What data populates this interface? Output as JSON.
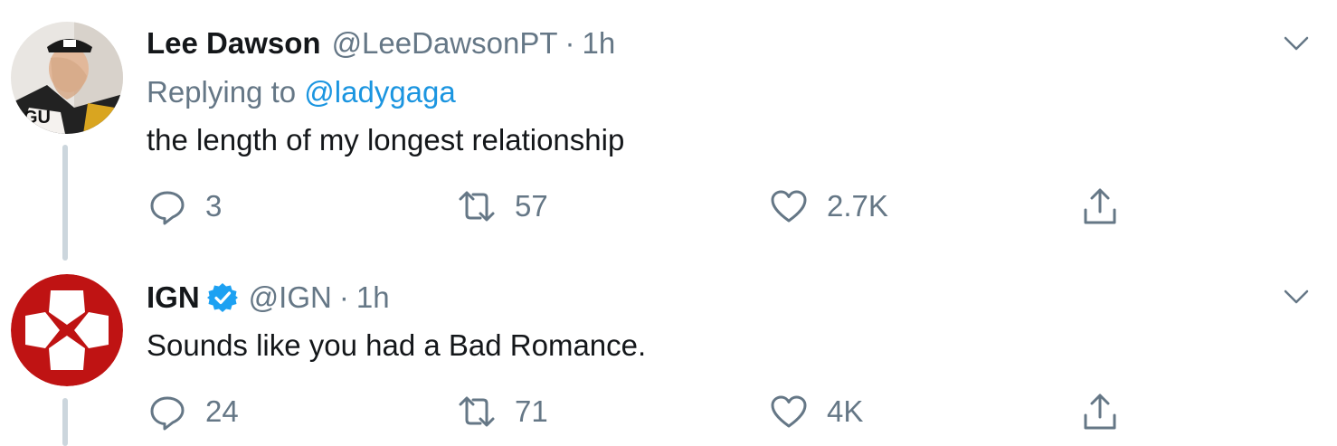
{
  "tweets": [
    {
      "author_name": "Lee Dawson",
      "handle": "@LeeDawsonPT",
      "separator": "·",
      "time": "1h",
      "replying_prefix": "Replying to",
      "replying_to": "@ladygaga",
      "text": "the length of my longest relationship",
      "replies": "3",
      "retweets": "57",
      "likes": "2.7K",
      "avatar_icon": "user-photo-avatar"
    },
    {
      "author_name": "IGN",
      "verified": true,
      "handle": "@IGN",
      "separator": "·",
      "time": "1h",
      "text": "Sounds like you had a Bad Romance.",
      "replies": "24",
      "retweets": "71",
      "likes": "4K",
      "avatar_icon": "ign-logo-avatar"
    }
  ],
  "colors": {
    "secondary_text": "#657786",
    "link": "#1b95e0",
    "verified": "#1da1f2",
    "ign_red": "#bf1313",
    "thread_line": "#ccd6dd"
  }
}
